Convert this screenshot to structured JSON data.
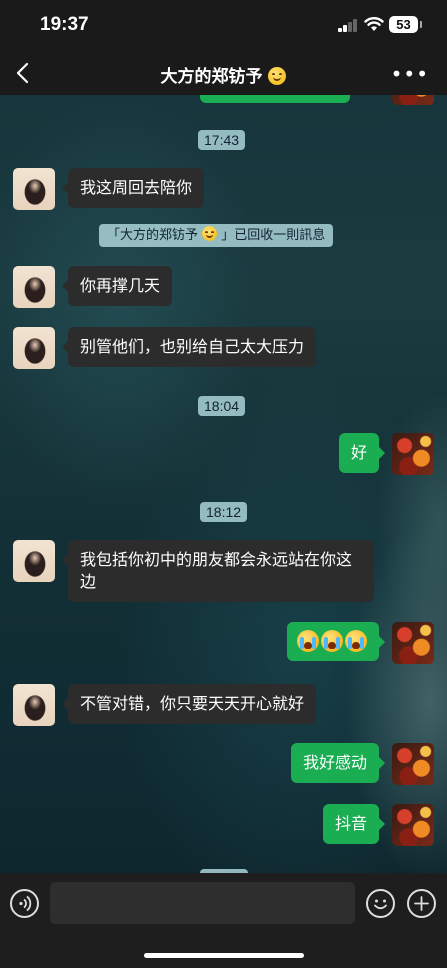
{
  "status_bar": {
    "time": "19:37",
    "battery": "53"
  },
  "header": {
    "title": "大方的郑钫予"
  },
  "messages": {
    "ts1": "17:43",
    "m1": "我这周回去陪你",
    "recall_prefix": "「大方的郑钫予",
    "recall_suffix": "」已回收一則訊息",
    "m2": "你再撑几天",
    "m3": "别管他们，也别给自己太大压力",
    "ts2": "18:04",
    "m4": "好",
    "ts3": "18:12",
    "m5": "我包括你初中的朋友都会永远站在你这边",
    "m6_emoji": "loudly-crying-face x3",
    "m7": "不管对错，你只要天天开心就好",
    "m8": "我好感动",
    "m9": "抖音"
  },
  "icons": {
    "back": "chevron-left-icon",
    "more": "more-icon",
    "voice": "voice-icon",
    "emoji": "emoji-icon",
    "plus": "plus-icon"
  },
  "colors": {
    "outgoing_bubble": "#1aad52",
    "incoming_bubble": "#2c2c2c"
  }
}
